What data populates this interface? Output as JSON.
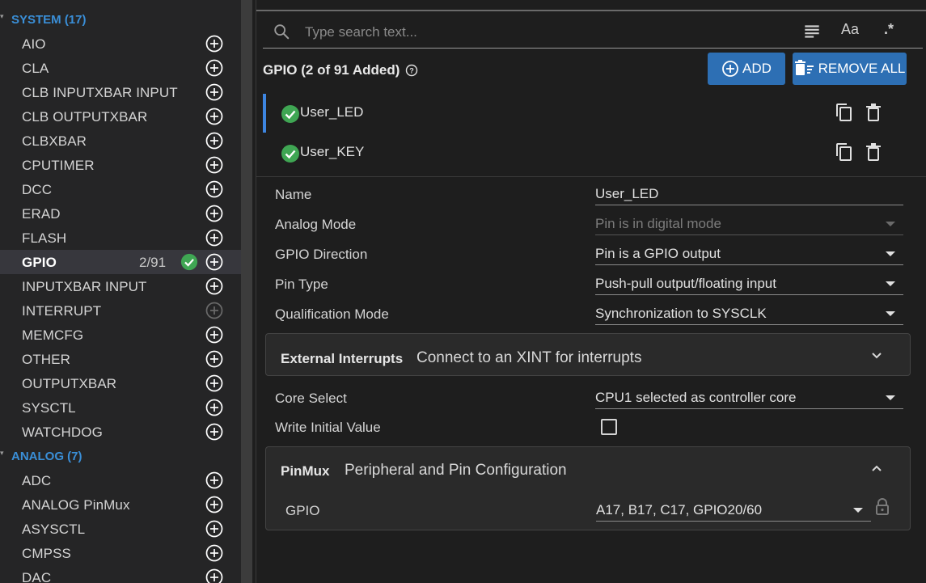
{
  "sidebar": {
    "categories": [
      {
        "label": "SYSTEM (17)"
      },
      {
        "label": "ANALOG (7)"
      }
    ],
    "system_items": [
      {
        "label": "AIO"
      },
      {
        "label": "CLA"
      },
      {
        "label": "CLB INPUTXBAR INPUT"
      },
      {
        "label": "CLB OUTPUTXBAR"
      },
      {
        "label": "CLBXBAR"
      },
      {
        "label": "CPUTIMER"
      },
      {
        "label": "DCC"
      },
      {
        "label": "ERAD"
      },
      {
        "label": "FLASH"
      },
      {
        "label": "GPIO",
        "count": "2/91"
      },
      {
        "label": "INPUTXBAR INPUT"
      },
      {
        "label": "INTERRUPT"
      },
      {
        "label": "MEMCFG"
      },
      {
        "label": "OTHER"
      },
      {
        "label": "OUTPUTXBAR"
      },
      {
        "label": "SYSCTL"
      },
      {
        "label": "WATCHDOG"
      }
    ],
    "analog_items": [
      {
        "label": "ADC"
      },
      {
        "label": "ANALOG PinMux"
      },
      {
        "label": "ASYSCTL"
      },
      {
        "label": "CMPSS"
      },
      {
        "label": "DAC"
      }
    ]
  },
  "search": {
    "placeholder": "Type search text..."
  },
  "toolbar": {
    "case_label": "Aa",
    "regex_label": ".*"
  },
  "gpio": {
    "heading": "GPIO (2 of 91 Added)",
    "add_label": "ADD",
    "remove_all_label": "REMOVE ALL",
    "instances": [
      {
        "name": "User_LED",
        "selected": true
      },
      {
        "name": "User_KEY",
        "selected": false
      }
    ]
  },
  "config": {
    "name": {
      "label": "Name",
      "value": "User_LED"
    },
    "analog_mode": {
      "label": "Analog Mode",
      "value": "Pin is in digital mode"
    },
    "gpio_direction": {
      "label": "GPIO Direction",
      "value": "Pin is a GPIO output"
    },
    "pin_type": {
      "label": "Pin Type",
      "value": "Push-pull output/floating input"
    },
    "qualification_mode": {
      "label": "Qualification Mode",
      "value": "Synchronization to SYSCLK"
    },
    "external_interrupts": {
      "title": "External Interrupts",
      "desc": "Connect to an XINT for interrupts"
    },
    "core_select": {
      "label": "Core Select",
      "value": "CPU1 selected as controller core"
    },
    "write_initial_value": {
      "label": "Write Initial Value"
    },
    "pinmux": {
      "title": "PinMux",
      "desc": "Peripheral and Pin Configuration",
      "gpio_label": "GPIO",
      "gpio_value": "A17, B17, C17, GPIO20/60"
    }
  },
  "colors": {
    "accent": "#2d6fb4",
    "category": "#3a8fd8",
    "check": "#3fa653",
    "selection_bar": "#3d85e0"
  }
}
